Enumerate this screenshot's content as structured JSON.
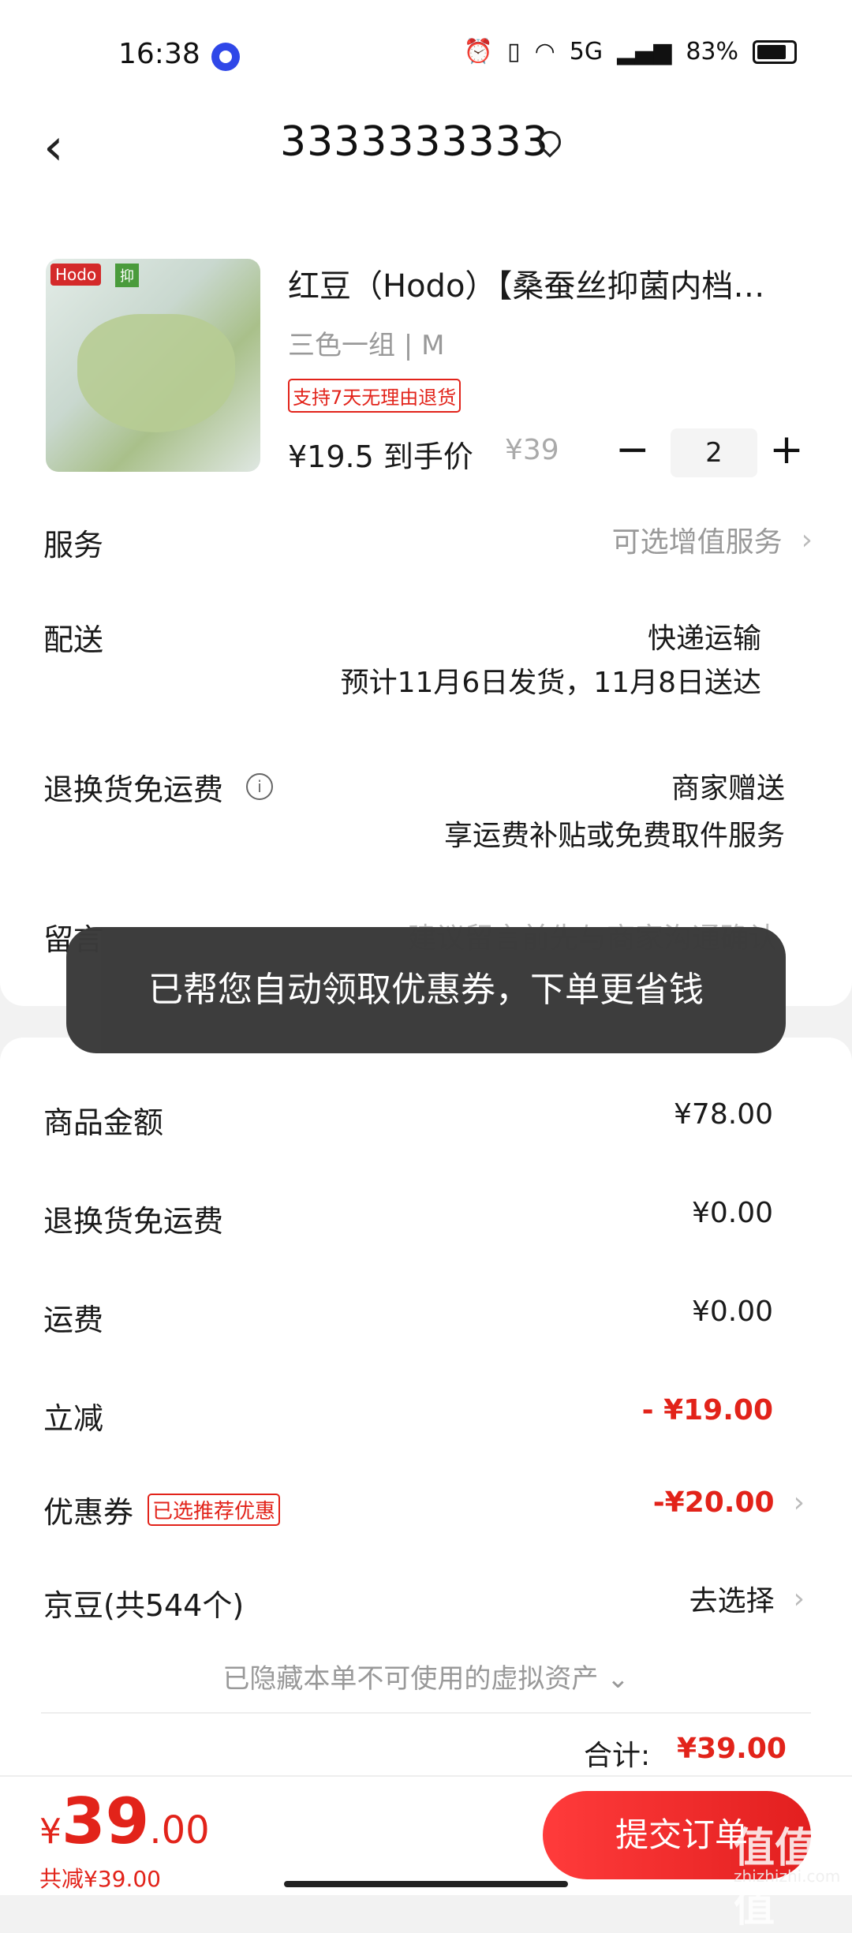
{
  "status_bar": {
    "time": "16:38",
    "network": "5G",
    "battery": "83%"
  },
  "header": {
    "back_icon": "chevron-left-icon",
    "address_title": "3333333333",
    "location_icon": "location-pin-icon"
  },
  "product": {
    "thumb_brand": "Hodo",
    "thumb_tag": "抑",
    "name": "红豆（Hodo）【桑蚕丝抑菌内档…",
    "spec": "三色一组 | M",
    "return_badge": "支持7天无理由退货",
    "price_line": "¥19.5 到手价",
    "original_price": "¥39",
    "quantity": "2",
    "minus_label": "−",
    "plus_label": "+"
  },
  "rows": {
    "service": {
      "label": "服务",
      "value": "可选增值服务",
      "chevron": "›"
    },
    "delivery": {
      "label": "配送",
      "method": "快递运输",
      "eta": "预计11月6日发货，11月8日送达"
    },
    "free_return": {
      "label": "退换货免运费",
      "info_icon": "i",
      "value": "商家赠送",
      "detail": "享运费补贴或免费取件服务"
    },
    "message": {
      "label": "留言",
      "placeholder": "建议留言前先与商家沟通确认"
    }
  },
  "toast": {
    "text": "已帮您自动领取优惠券，下单更省钱"
  },
  "summary": {
    "goods": {
      "label": "商品金额",
      "value": "¥78.00"
    },
    "return_shipping": {
      "label": "退换货免运费",
      "value": "¥0.00"
    },
    "shipping": {
      "label": "运费",
      "value": "¥0.00"
    },
    "instant_discount": {
      "label": "立减",
      "value": "- ¥19.00"
    },
    "coupon": {
      "label": "优惠券",
      "tag": "已选推荐优惠",
      "value": "-¥20.00",
      "chevron": "›"
    },
    "jd_beans": {
      "label": "京豆(共544个)",
      "value": "去选择",
      "chevron": "›"
    },
    "hidden_assets": "已隐藏本单不可使用的虚拟资产 ⌄",
    "total_label": "合计:",
    "total_value": "¥39.00"
  },
  "bottom": {
    "currency": "¥",
    "price_int": "39",
    "price_dec": ".00",
    "saved": "共减¥39.00",
    "submit": "提交订单"
  },
  "watermark": {
    "text": "值值值",
    "sub": "zhizhizhi.com"
  },
  "colors": {
    "accent_red": "#e2231a",
    "toast_bg": "#3a3a3a"
  }
}
